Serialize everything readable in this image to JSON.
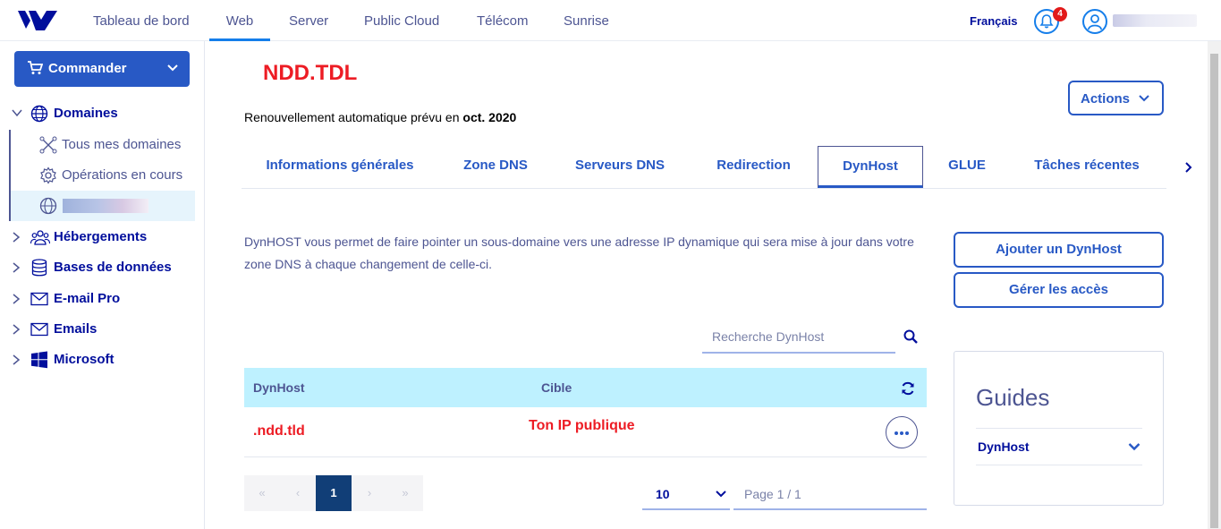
{
  "topnav": {
    "items": [
      "Tableau de bord",
      "Web",
      "Server",
      "Public Cloud",
      "Télécom",
      "Sunrise"
    ],
    "active": "Web",
    "language": "Français",
    "notifications_count": "4"
  },
  "sidebar": {
    "order_button": "Commander",
    "domains_label": "Domaines",
    "domain_subitems": [
      "Tous mes domaines",
      "Opérations en cours"
    ],
    "sections": [
      "Hébergements",
      "Bases de données",
      "E-mail Pro",
      "Emails",
      "Microsoft"
    ]
  },
  "header": {
    "title": "NDD.TDL",
    "renewal_text": "Renouvellement automatique prévu en ",
    "renewal_date": "oct. 2020",
    "actions_button": "Actions"
  },
  "tabs": [
    "Informations générales",
    "Zone DNS",
    "Serveurs DNS",
    "Redirection",
    "DynHost",
    "GLUE",
    "Tâches récentes"
  ],
  "active_tab": "DynHost",
  "description": "DynHOST vous permet de faire pointer un sous-domaine vers une adresse IP dynamique qui sera mise à jour dans votre zone DNS à chaque changement de celle-ci.",
  "buttons": {
    "add": "Ajouter un DynHost",
    "manage": "Gérer les accès"
  },
  "search": {
    "placeholder": "Recherche DynHost"
  },
  "table": {
    "columns": [
      "DynHost",
      "Cible"
    ],
    "rows": [
      {
        "dynhost": ".ndd.tld",
        "target": "Ton IP publique"
      }
    ]
  },
  "pagination": {
    "first": "«",
    "prev": "‹",
    "current": "1",
    "next": "›",
    "last": "»",
    "per_page": "10",
    "page_info": "Page 1 / 1"
  },
  "guides": {
    "title": "Guides",
    "item": "DynHost"
  },
  "colors": {
    "accent": "#2859c5",
    "table_header": "#bef1ff",
    "annotation_red": "#ed1c24"
  }
}
